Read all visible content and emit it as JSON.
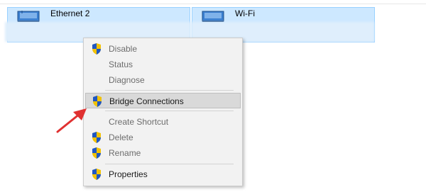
{
  "adapters": [
    {
      "name": "Ethernet 2",
      "icon": "network-adapter-icon"
    },
    {
      "name": "Wi-Fi",
      "icon": "network-adapter-icon"
    }
  ],
  "context_menu": {
    "items": [
      {
        "label": "Disable",
        "shield": true,
        "state": "disabled"
      },
      {
        "label": "Status",
        "shield": false,
        "state": "disabled"
      },
      {
        "label": "Diagnose",
        "shield": false,
        "state": "disabled"
      },
      {
        "label": "Bridge Connections",
        "shield": true,
        "state": "highlighted"
      },
      {
        "label": "Create Shortcut",
        "shield": false,
        "state": "disabled"
      },
      {
        "label": "Delete",
        "shield": true,
        "state": "disabled"
      },
      {
        "label": "Rename",
        "shield": true,
        "state": "disabled"
      },
      {
        "label": "Properties",
        "shield": true,
        "state": "enabled"
      }
    ]
  },
  "colors": {
    "selection_bg": "#cde8ff",
    "selection_border": "#99d1ff",
    "menu_bg": "#f2f2f2",
    "highlight_bg": "#d9d9d9",
    "arrow": "#e03131",
    "shield_blue": "#1f57c3",
    "shield_yellow": "#f2c200"
  }
}
